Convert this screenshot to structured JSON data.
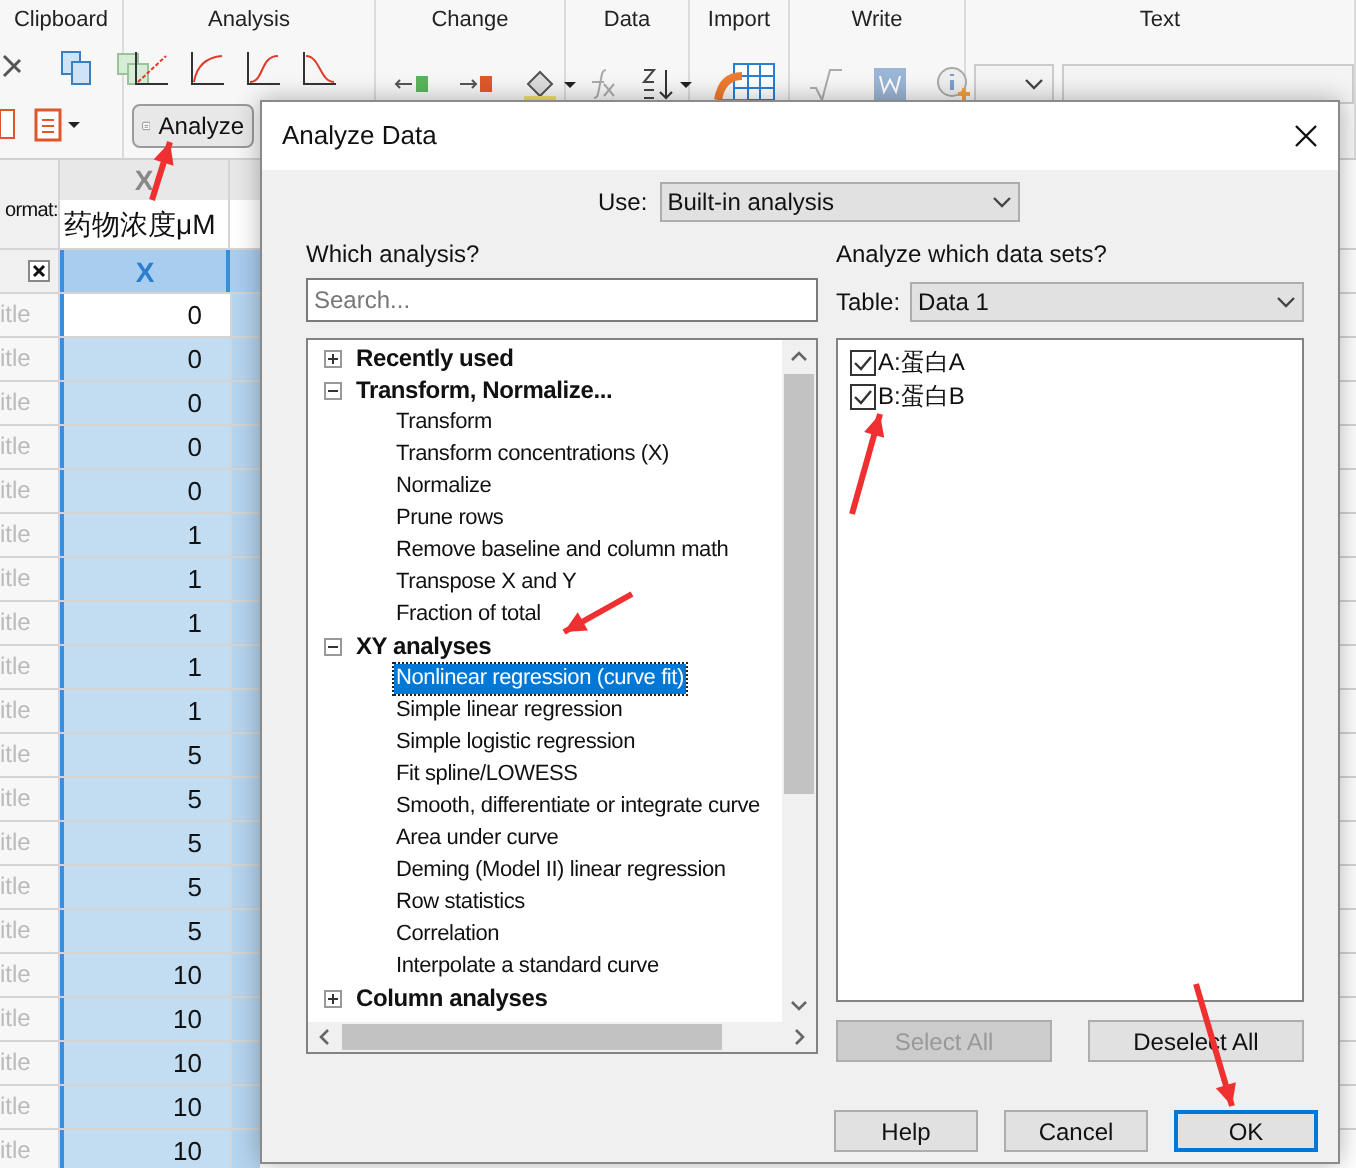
{
  "ribbon": {
    "groups": [
      {
        "kind": "clipboard",
        "label": "Clipboard"
      },
      {
        "kind": "analysis",
        "label": "Analysis",
        "button": "Analyze"
      },
      {
        "kind": "change",
        "label": "Change"
      },
      {
        "kind": "data",
        "label": "Data"
      },
      {
        "kind": "import",
        "label": "Import"
      },
      {
        "kind": "write",
        "label": "Write"
      },
      {
        "kind": "text",
        "label": "Text"
      }
    ]
  },
  "sheet": {
    "row_header": "ormat:",
    "column_letter": "X",
    "column_title": "药物浓度μM",
    "column_subheader": "X",
    "rows": [
      {
        "title": "itle",
        "value": "0",
        "selected": false
      },
      {
        "title": "itle",
        "value": "0",
        "selected": true
      },
      {
        "title": "itle",
        "value": "0",
        "selected": true
      },
      {
        "title": "itle",
        "value": "0",
        "selected": true
      },
      {
        "title": "itle",
        "value": "0",
        "selected": true
      },
      {
        "title": "itle",
        "value": "1",
        "selected": true
      },
      {
        "title": "itle",
        "value": "1",
        "selected": true
      },
      {
        "title": "itle",
        "value": "1",
        "selected": true
      },
      {
        "title": "itle",
        "value": "1",
        "selected": true
      },
      {
        "title": "itle",
        "value": "1",
        "selected": true
      },
      {
        "title": "itle",
        "value": "5",
        "selected": true
      },
      {
        "title": "itle",
        "value": "5",
        "selected": true
      },
      {
        "title": "itle",
        "value": "5",
        "selected": true
      },
      {
        "title": "itle",
        "value": "5",
        "selected": true
      },
      {
        "title": "itle",
        "value": "5",
        "selected": true
      },
      {
        "title": "itle",
        "value": "10",
        "selected": true
      },
      {
        "title": "itle",
        "value": "10",
        "selected": true
      },
      {
        "title": "itle",
        "value": "10",
        "selected": true
      },
      {
        "title": "itle",
        "value": "10",
        "selected": true
      },
      {
        "title": "itle",
        "value": "10",
        "selected": true
      }
    ]
  },
  "dialog": {
    "title": "Analyze Data",
    "use_label": "Use:",
    "use_value": "Built-in analysis",
    "which_heading": "Which analysis?",
    "search": {
      "placeholder": "Search..."
    },
    "tree": [
      {
        "label": "Recently used",
        "expanded": false
      },
      {
        "label": "Transform, Normalize...",
        "expanded": true,
        "children": [
          {
            "label": "Transform",
            "selected": false
          },
          {
            "label": "Transform concentrations (X)",
            "selected": false
          },
          {
            "label": "Normalize",
            "selected": false
          },
          {
            "label": "Prune rows",
            "selected": false
          },
          {
            "label": "Remove baseline and column math",
            "selected": false
          },
          {
            "label": "Transpose X and Y",
            "selected": false
          },
          {
            "label": "Fraction of total",
            "selected": false
          }
        ]
      },
      {
        "label": "XY analyses",
        "expanded": true,
        "children": [
          {
            "label": "Nonlinear regression (curve fit)",
            "selected": true
          },
          {
            "label": "Simple linear regression",
            "selected": false
          },
          {
            "label": "Simple logistic regression",
            "selected": false
          },
          {
            "label": "Fit spline/LOWESS",
            "selected": false
          },
          {
            "label": "Smooth, differentiate or integrate curve",
            "selected": false
          },
          {
            "label": "Area under curve",
            "selected": false
          },
          {
            "label": "Deming (Model II) linear regression",
            "selected": false
          },
          {
            "label": "Row statistics",
            "selected": false
          },
          {
            "label": "Correlation",
            "selected": false
          },
          {
            "label": "Interpolate a standard curve",
            "selected": false
          }
        ]
      },
      {
        "label": "Column analyses",
        "expanded": false
      }
    ],
    "datasets_heading": "Analyze which data sets?",
    "table_label": "Table:",
    "table_value": "Data 1",
    "datasets": [
      {
        "label": "A:蛋白A",
        "checked": true
      },
      {
        "label": "B:蛋白B",
        "checked": true
      }
    ],
    "select_all": {
      "label": "Select All",
      "disabled": true
    },
    "deselect_all": {
      "label": "Deselect All",
      "disabled": false
    },
    "buttons": [
      {
        "label": "Help",
        "default": false
      },
      {
        "label": "Cancel",
        "default": false
      },
      {
        "label": "OK",
        "default": true
      }
    ]
  }
}
